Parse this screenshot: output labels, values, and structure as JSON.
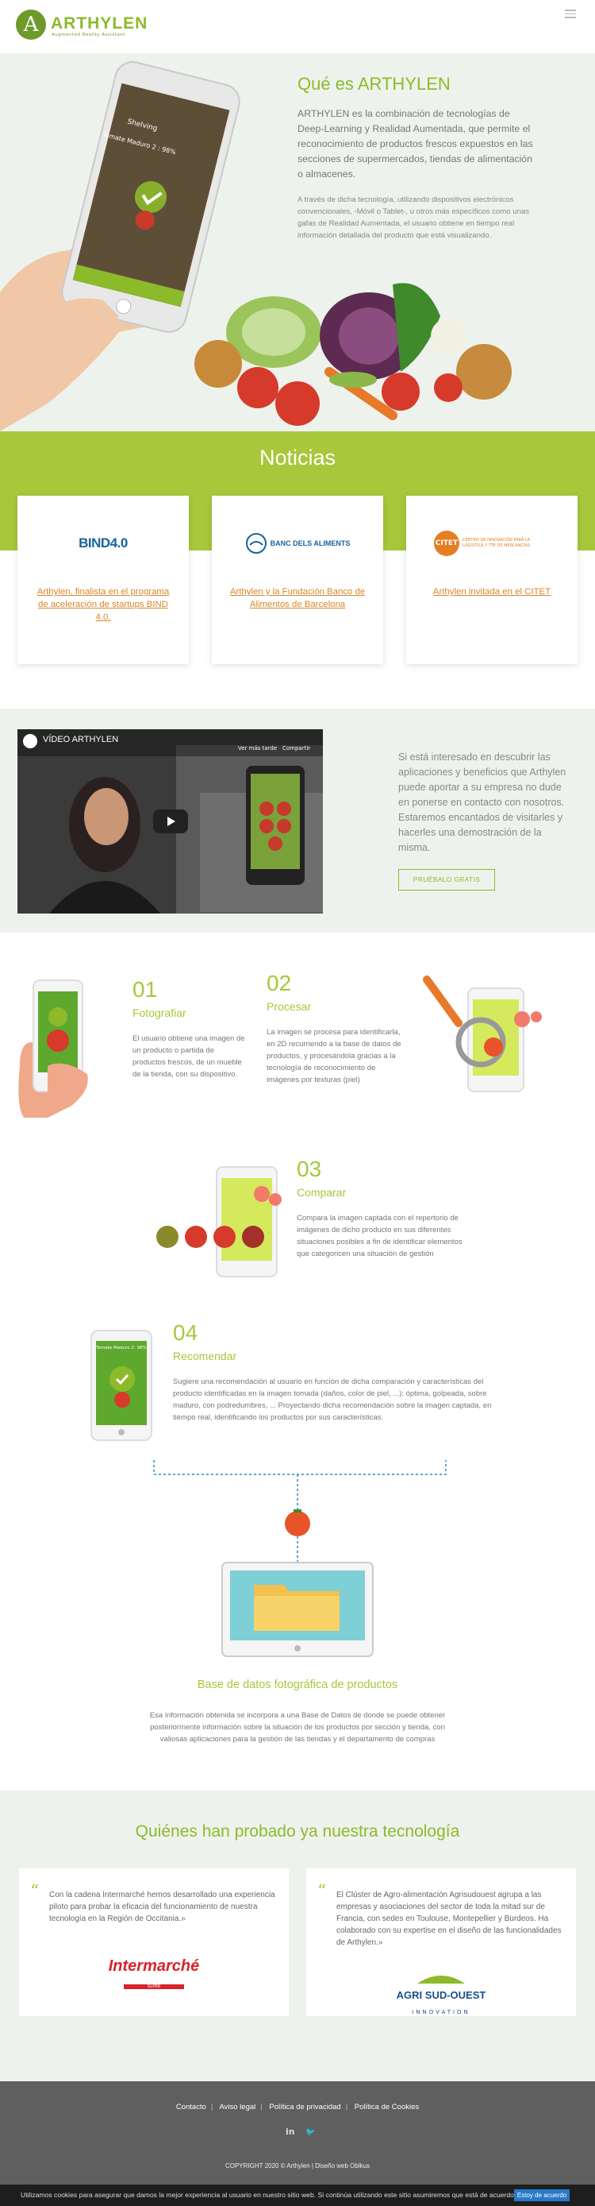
{
  "brand": {
    "name": "ARTHYLEN",
    "tagline": "Augmented Reality Assistant",
    "logo_letter": "A"
  },
  "header": {
    "menu_icon": "hamburger-icon"
  },
  "hero": {
    "title": "Qué es ARTHYLEN",
    "paragraph1": "ARTHYLEN es la combinación de tecnologías de Deep-Learning y Realidad Aumentada, que permite el reconocimiento de productos frescos expuestos en las secciones de supermercados, tiendas de alimentación o almacenes.",
    "paragraph2": "A través de dicha tecnología, utilizando dispositivos electrónicos convencionales, -Móvil o Tablet-, u otros más específicos como unas gafas de Realidad Aumentada, el usuario obtiene en tiempo real información detallada del producto que está visualizando.",
    "phone_header": "Shelving",
    "phone_label": "Tomate Maduro 2 : 98%"
  },
  "news": {
    "title": "Noticias",
    "items": [
      {
        "logo_text": "BIND4.0",
        "link": "Arthylen, finalista en el programa de aceleración de startups BIND 4.0."
      },
      {
        "logo_text": "BANC DELS ALIMENTS",
        "link": "Arthylen y la Fundación Banco de Alimentos de Barcelona"
      },
      {
        "logo_text": "CITET",
        "logo_sub": "CENTRO DE INNOVACIÓN PARA LA LOGÍSTICA Y TTE DE MERCANCÍAS",
        "link": "Arthylen invitada en el CITET"
      }
    ]
  },
  "video": {
    "title": "VÍDEO ARTHYLEN",
    "watch_later": "Ver más tarde",
    "share": "Compartir",
    "text": "Si está interesado en descubrir las aplicaciones y beneficios que Arthylen puede aportar a su empresa no dude en ponerse en contacto con nosotros. Estaremos encantados de visitarles y hacerles una demostración de la misma.",
    "button": "PRUÉBALO GRATIS"
  },
  "steps": [
    {
      "num": "01",
      "title": "Fotografiar",
      "desc": "El usuario obtiene una imagen de un producto o partida de productos frescos, de un mueble de la tienda, con su dispositivo."
    },
    {
      "num": "02",
      "title": "Procesar",
      "desc": "La imagen se procesa para identificarla, en 2D recurriendo a la base de datos de productos, y procesándola gracias a la tecnología de reconocimiento de imágenes por texturas (piel)"
    },
    {
      "num": "03",
      "title": "Comparar",
      "desc": "Compara la imagen captada con el repertorio de imágenes de dicho producto en sus diferentes situaciones posibles a fin de identificar elementos que categoricen una situación de gestión"
    },
    {
      "num": "04",
      "title": "Recomendar",
      "desc": "Sugiere una recomendación al usuario en función de dicha comparación y características del producto identificadas en la imagen tomada (daños, color de piel, ...): óptima, golpeada, sobre maduro, con podredumbres, ... Proyectando dicha recomendación sobre la imagen captada, en tiempo real, identificando los productos por sus características.",
      "phone_label": "Tomate Maduro 2: 98%"
    }
  ],
  "database": {
    "title": "Base de datos fotográfica de productos",
    "desc": "Esa información obtenida se incorpora a una Base de Datos de donde se puede obtener posteriormente información sobre la situación de los productos por sección y tienda, con valiosas aplicaciones para la gestión de las tiendas y el departamento de compras"
  },
  "testimonials": {
    "title": "Quiénes han probado ya nuestra tecnología",
    "items": [
      {
        "quote": "Con la cadena Intermarché hemos desarrollado una experiencia piloto para probar la eficacia del funcionamiento de nuestra tecnología en la Región de Occitania.»",
        "logo": "Intermarché",
        "logo_sub": "SUPER"
      },
      {
        "quote": "El Clúster de Agro-alimentación Agrisudouest agrupa a las empresas y asociaciones del sector de toda la mitad sur de Francia, con sedes en Toulouse, Montepellier y Burdeos. Ha colaborado con su expertise en el diseño de las funcionalidades de Arthylen.»",
        "logo": "AGRI SUD-OUEST",
        "logo_sub": "INNOVATION"
      }
    ]
  },
  "footer": {
    "links": [
      "Contacto",
      "Aviso legal",
      "Política de privacidad",
      "Política de Cookies"
    ],
    "social": [
      "linkedin-icon",
      "twitter-icon"
    ],
    "social_glyphs": {
      "linkedin": "in",
      "twitter": "🐦"
    },
    "copyright": "COPYRIGHT 2020 © Arthylen | Diseño web Oblkus"
  },
  "cookie": {
    "text": "Utilizamos cookies para asegurar que damos la mejor experiencia al usuario en nuestro sitio web. Si continúa utilizando este sitio asumiremos que está de acuerdo.",
    "button": "Estoy de acuerdo"
  },
  "colors": {
    "brand_green": "#8dba2b",
    "band_green": "#a6c83a",
    "bg_mint": "#edf3ec",
    "link_orange": "#d9862a",
    "footer_grey": "#5f5f5f"
  }
}
